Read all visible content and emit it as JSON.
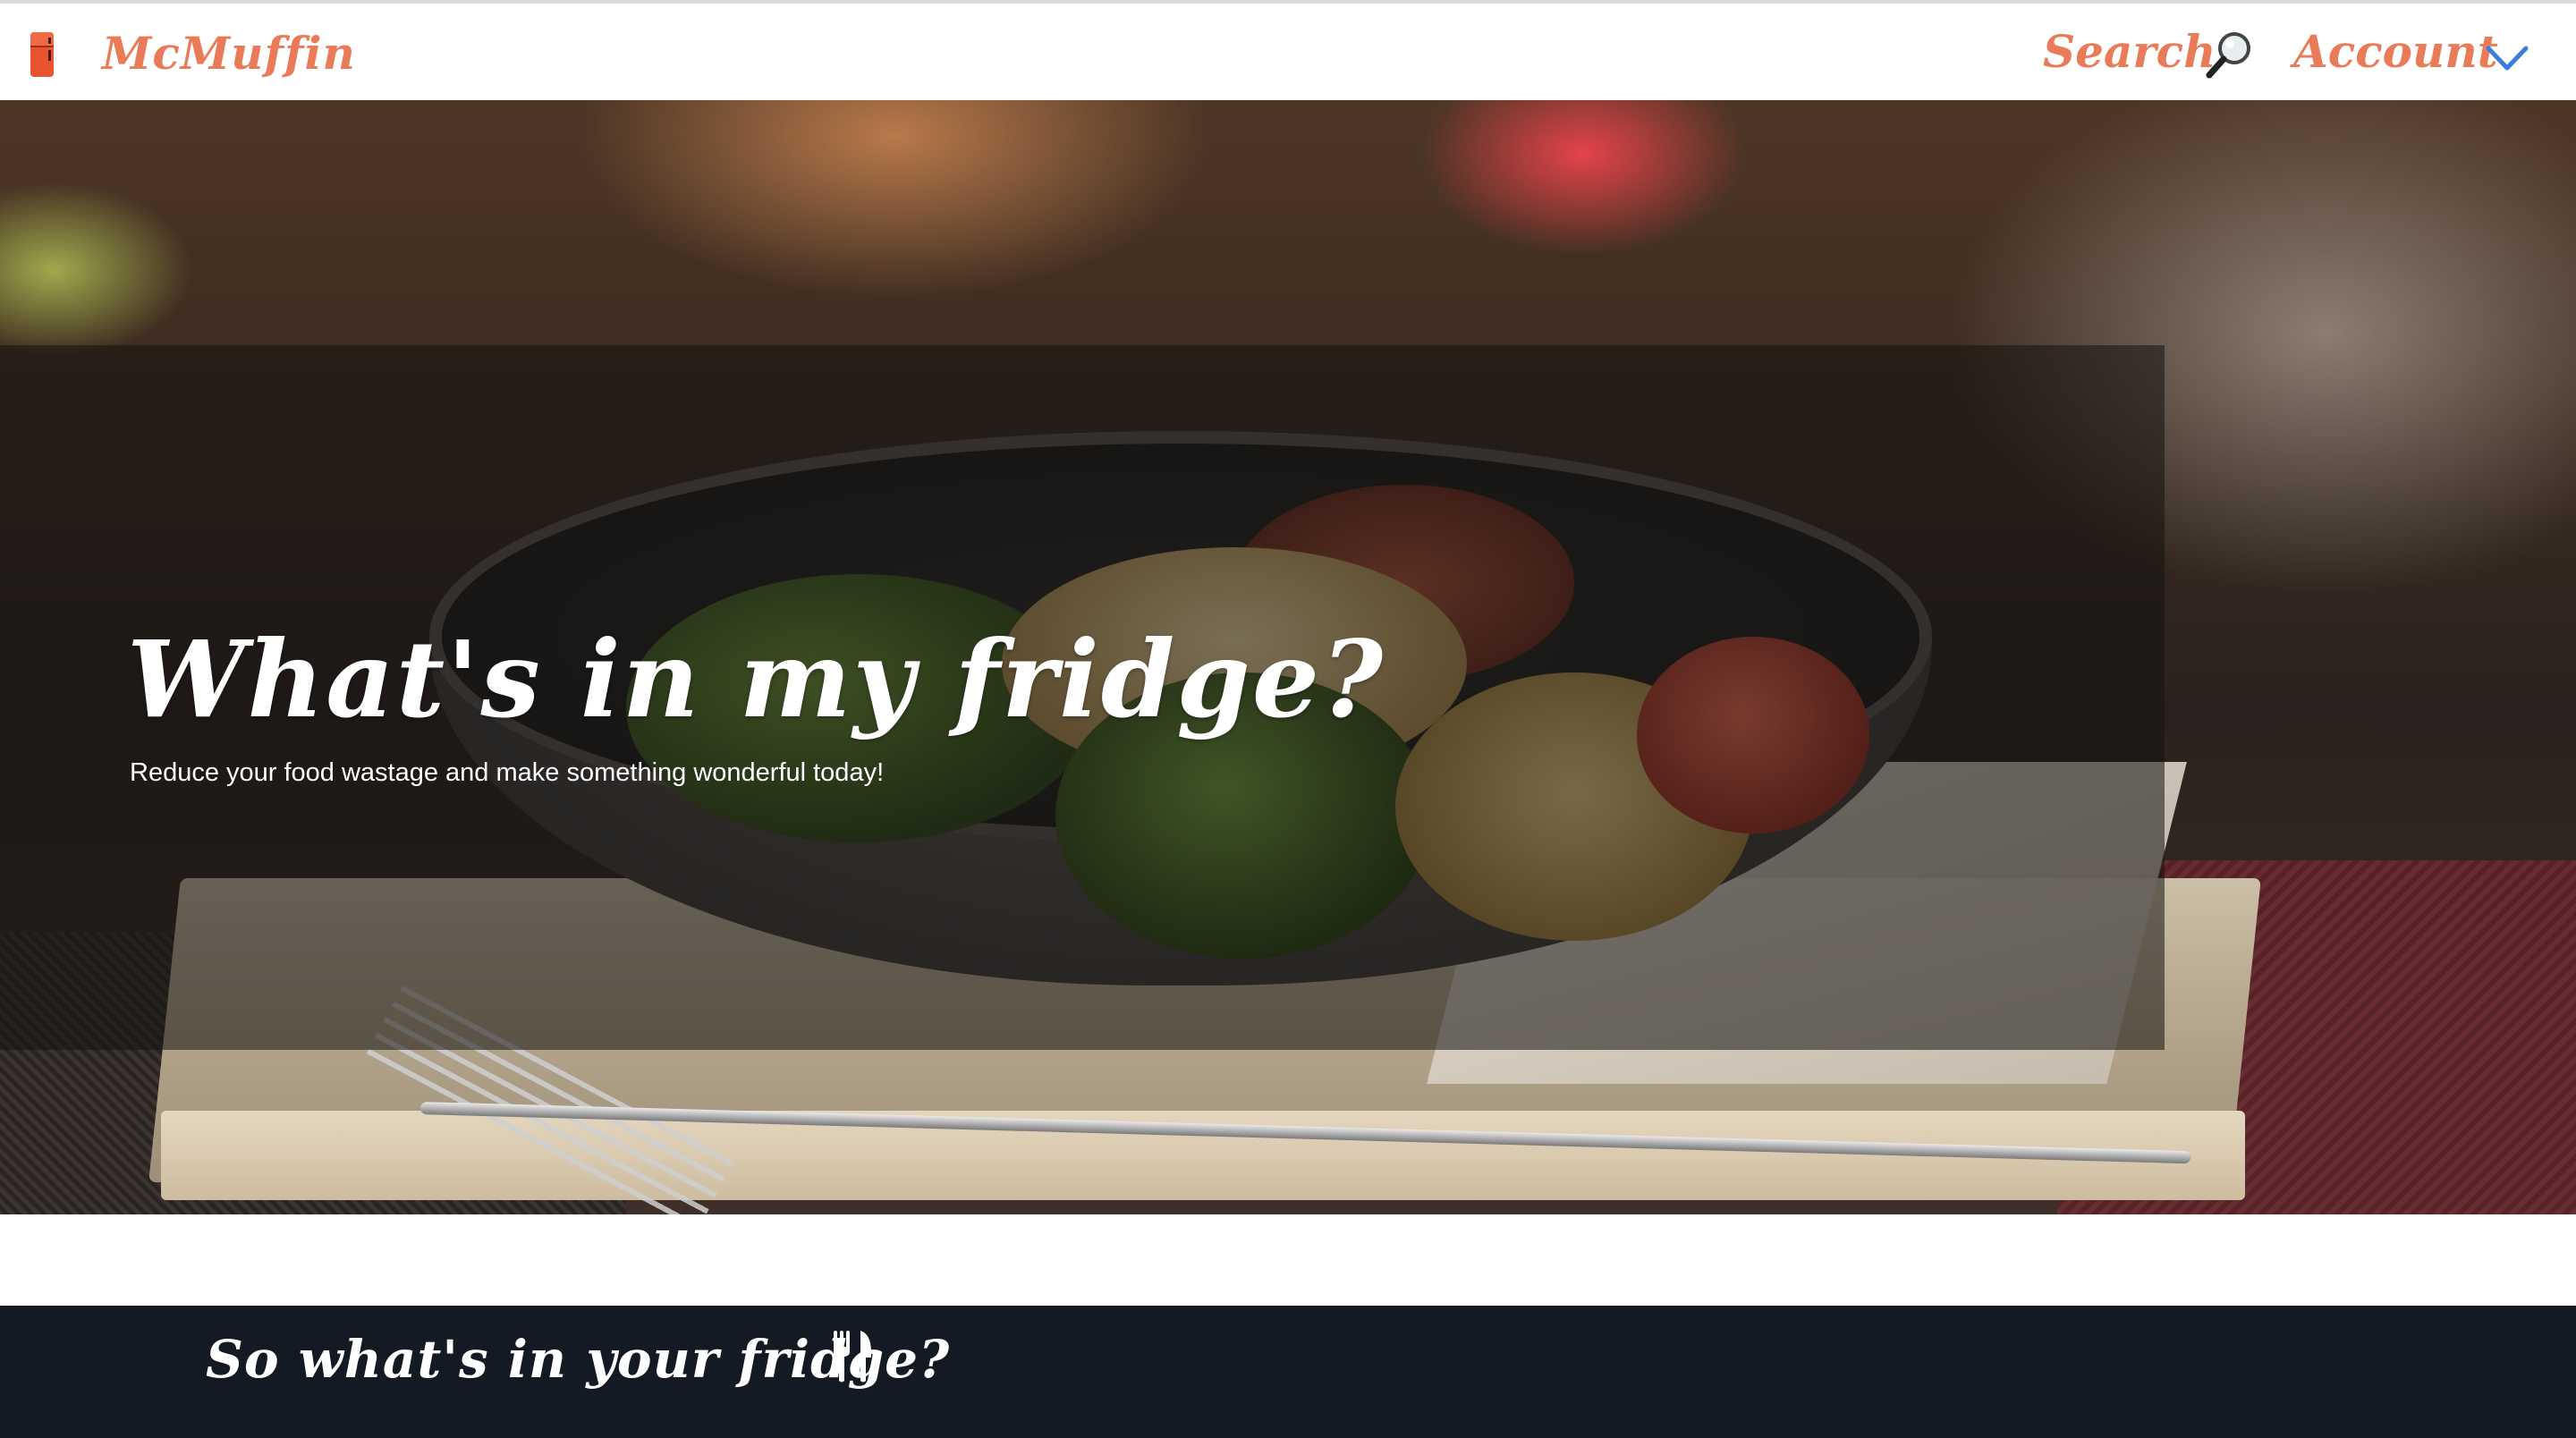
{
  "navbar": {
    "brand": "McMuffin",
    "search_label": "Search",
    "account_label": "Account",
    "icons": {
      "logo": "fridge-icon",
      "search": "magnifier-icon",
      "account_menu": "chevron-down-icon"
    }
  },
  "hero": {
    "title": "What's in my fridge?",
    "subtitle": "Reduce your food wastage and make something wonderful today!"
  },
  "section": {
    "title": "So what's in your fridge?",
    "icon": "fork-knife-icon"
  },
  "colors": {
    "brand": "#ea7b58",
    "chevron": "#3b7ddd",
    "footer_band": "#131a24"
  }
}
